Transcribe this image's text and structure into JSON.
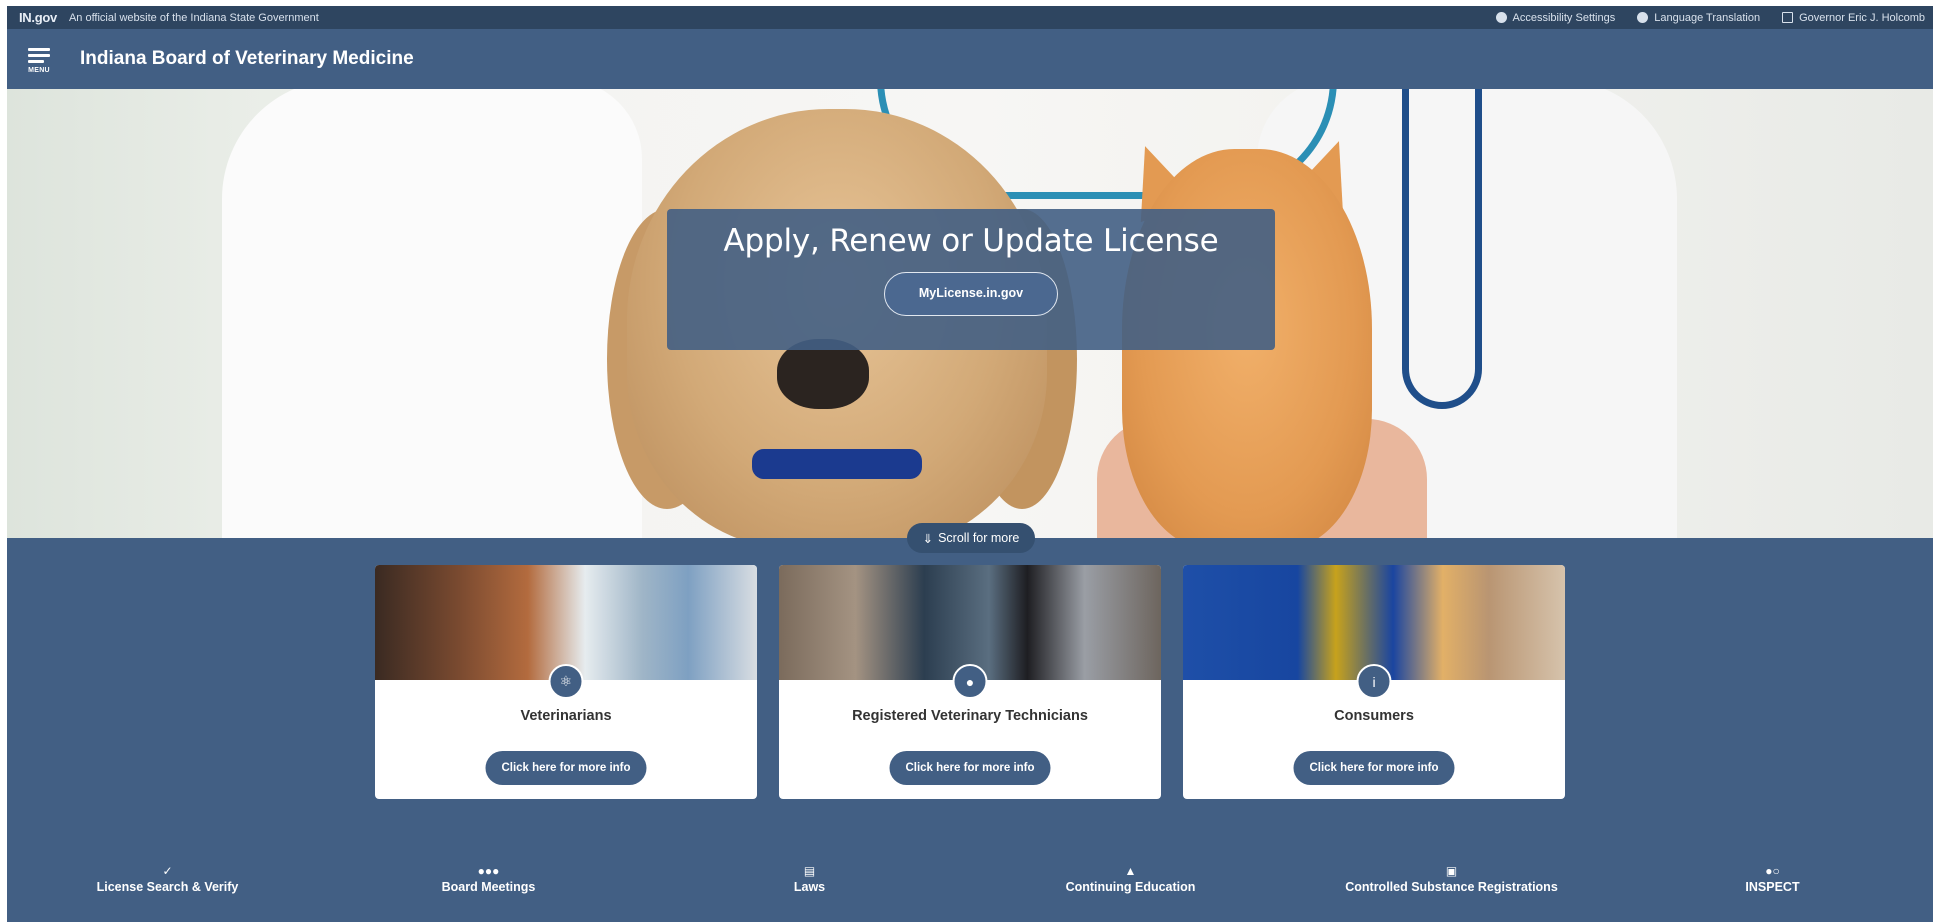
{
  "utility_bar": {
    "logo": "IN.gov",
    "official_text": "An official website of the Indiana State Government",
    "links": [
      {
        "icon": "accessibility-icon",
        "label": "Accessibility Settings"
      },
      {
        "icon": "globe-icon",
        "label": "Language Translation"
      },
      {
        "icon": "external-link-icon",
        "label": "Governor Eric J. Holcomb"
      }
    ]
  },
  "header": {
    "menu_label": "MENU",
    "site_title": "Indiana Board of Veterinary Medicine"
  },
  "hero": {
    "heading": "Apply, Renew or Update License",
    "button_label": "MyLicense.in.gov",
    "scroll_label": "Scroll for more"
  },
  "cards": [
    {
      "title": "Veterinarians",
      "icon": "stethoscope-icon",
      "button": "Click here for more info"
    },
    {
      "title": "Registered Veterinary Technicians",
      "icon": "person-icon",
      "button": "Click here for more info"
    },
    {
      "title": "Consumers",
      "icon": "info-icon",
      "button": "Click here for more info"
    }
  ],
  "quick_links": [
    {
      "icon": "checkmark-icon",
      "label": "License Search & Verify"
    },
    {
      "icon": "people-group-icon",
      "label": "Board Meetings"
    },
    {
      "icon": "scroll-icon",
      "label": "Laws"
    },
    {
      "icon": "graduation-cap-icon",
      "label": "Continuing Education"
    },
    {
      "icon": "id-card-icon",
      "label": "Controlled Substance Registrations"
    },
    {
      "icon": "pills-icon",
      "label": "INSPECT"
    }
  ],
  "colors": {
    "primary": "#425f84",
    "utility_bar": "#2e4560",
    "card_bg": "#ffffff"
  }
}
